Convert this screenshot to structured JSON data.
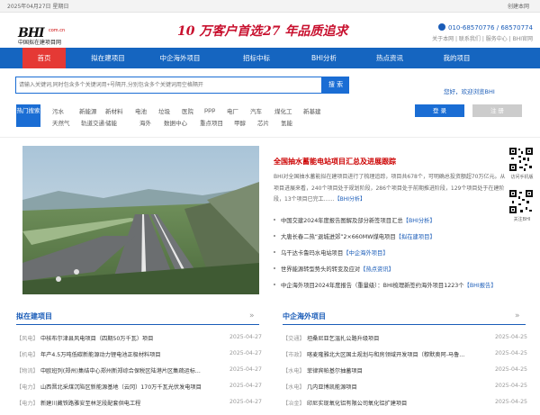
{
  "topbar": {
    "date": "2025年04月27日 星期日",
    "right_link": "创建本网"
  },
  "header": {
    "logo_text": "BHI",
    "logo_domain": "com.cn",
    "logo_subtitle": "中国拟在建项目网",
    "slogan1": "10 万客户首选",
    "slogan2": "27 年品质追求",
    "phone": "010-68570776 / 68570774",
    "links": "关于本网 | 联系我们 | 服务中心 | BHI官网"
  },
  "nav": {
    "items": [
      "首页",
      "拟在建项目",
      "中企海外项目",
      "招标中标",
      "BHI分析",
      "热点资讯",
      "我的项目"
    ],
    "active_index": 0
  },
  "search": {
    "placeholder": "请输入关键词,同时包含多个关键词用+号隔开,分别包含多个关键词用空格隔开",
    "button": "搜 索"
  },
  "welcome": "您好，欢迎浏览BHI",
  "hot": {
    "label": "热门搜索",
    "row1": [
      "污水",
      "新能源",
      "新材料",
      "电池",
      "垃圾",
      "医院",
      "ppp",
      "电厂",
      "汽车",
      "煤化工",
      "新基建"
    ],
    "row2": [
      "天然气",
      "轨道交通",
      "储能",
      "海外",
      "数据中心",
      "重点项目",
      "甲醇",
      "芯片",
      "氢能"
    ]
  },
  "auth": {
    "login": "登 录",
    "register": "注 册"
  },
  "featured": {
    "title": "全国抽水蓄能电站项目汇总及进展跟踪",
    "description": "BHI对全国抽水蓄能拟在建项目进行了梳理追踪，项目共678个，可明确总投资额超70万亿元。从项目进展来看，240个项目处于规划阶段，286个项目处于前期推进阶段，129个项目处于在建阶段，13个项目已完工……",
    "more": "【BHI分析】"
  },
  "news": [
    {
      "title": "中国交建2024年度报告图解及部分新签项目汇总",
      "source": "【BHI分析】"
    },
    {
      "title": "大唐长春二热“退城进郊”2×660MW煤电项目",
      "source": "【拟在建项目】"
    },
    {
      "title": "乌干达卡鲁玛水电站项目",
      "source": "【中企海外项目】"
    },
    {
      "title": "世界能源转型势头的转变及应对",
      "source": "【热点资讯】"
    },
    {
      "title": "中企海外项目2024年度报告（重量级）：BHI梳理新签约海外项目1223个",
      "source": "【BHI报告】"
    }
  ],
  "qr": {
    "caption1": "访问手机版",
    "caption2": "关注BHI"
  },
  "sections": {
    "left": {
      "title": "拟在建项目",
      "more": "»",
      "rows": [
        {
          "tag": "【风电】",
          "title": "中核布尔津县风电项目（四期50万千瓦）项目",
          "date": "2025-04-27"
        },
        {
          "tag": "【机电】",
          "title": "年产4.5万吨低碳新能源动力锂电池正极材料项目",
          "date": "2025-04-27"
        },
        {
          "tag": "【物流】",
          "title": "中欧班列(郑州)集结中心郑州新郑综合保税区陆港片区集疏运标...",
          "date": "2025-04-27"
        },
        {
          "tag": "【电力】",
          "title": "山西晋北采煤沉陷区新能源基地（云冈）170万千瓦光伏发电项目",
          "date": "2025-04-27"
        },
        {
          "tag": "【电力】",
          "title": "新建川藏铁路雅安至林芝段配套供电工程",
          "date": "2025-04-27"
        }
      ]
    },
    "right": {
      "title": "中企海外项目",
      "more": "»",
      "rows": [
        {
          "tag": "【交通】",
          "title": "坦桑尼亚乞温扎公路升级项目",
          "date": "2025-04-25"
        },
        {
          "tag": "【市政】",
          "title": "喀麦隆雅北大区国土规划与和房领域开发项目（穆默奥阿-马鲁...",
          "date": "2025-04-25"
        },
        {
          "tag": "【水电】",
          "title": "菲律宾帕基尔抽蓄项目",
          "date": "2025-04-25"
        },
        {
          "tag": "【水电】",
          "title": "几内亚博凯能源项目",
          "date": "2025-04-25"
        },
        {
          "tag": "【冶金】",
          "title": "印尼实现氧化铝有限公司氧化铝扩建项目",
          "date": "2025-04-25"
        }
      ]
    }
  }
}
